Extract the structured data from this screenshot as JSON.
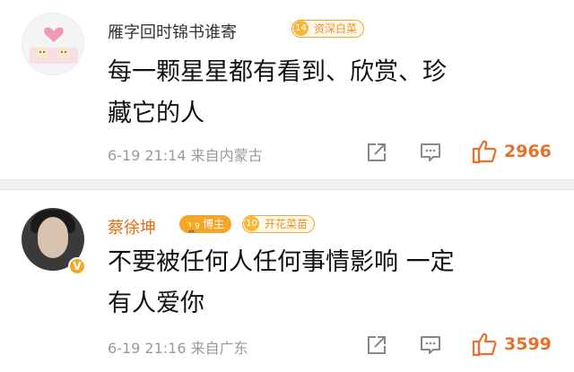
{
  "comments": [
    {
      "user": "雁字回时锦书谁寄",
      "level": "14",
      "level_label": "资深白菜",
      "text_line1": "每一颗星星都有看到、欣赏、珍",
      "text_line2": "藏它的人",
      "meta": "6-19 21:14  来自内蒙古",
      "likes": "2966"
    },
    {
      "user": "蔡徐坤",
      "badge_label": "博主",
      "badge_num": "9",
      "level": "10",
      "level_label": "开花菜苗",
      "verified": "V",
      "text_line1": "不要被任何人任何事情影响 一定",
      "text_line2": "有人爱你",
      "meta": "6-19 21:16  来自广东",
      "likes": "3599"
    }
  ],
  "colors": {
    "accent": "#e8712a",
    "name_highlight": "#e86b12",
    "meta_gray": "#9a9a9a",
    "badge_gold": "#f4a52a"
  },
  "icons": {
    "share": "share-icon",
    "comment": "comment-icon",
    "like": "thumbs-up-icon"
  }
}
